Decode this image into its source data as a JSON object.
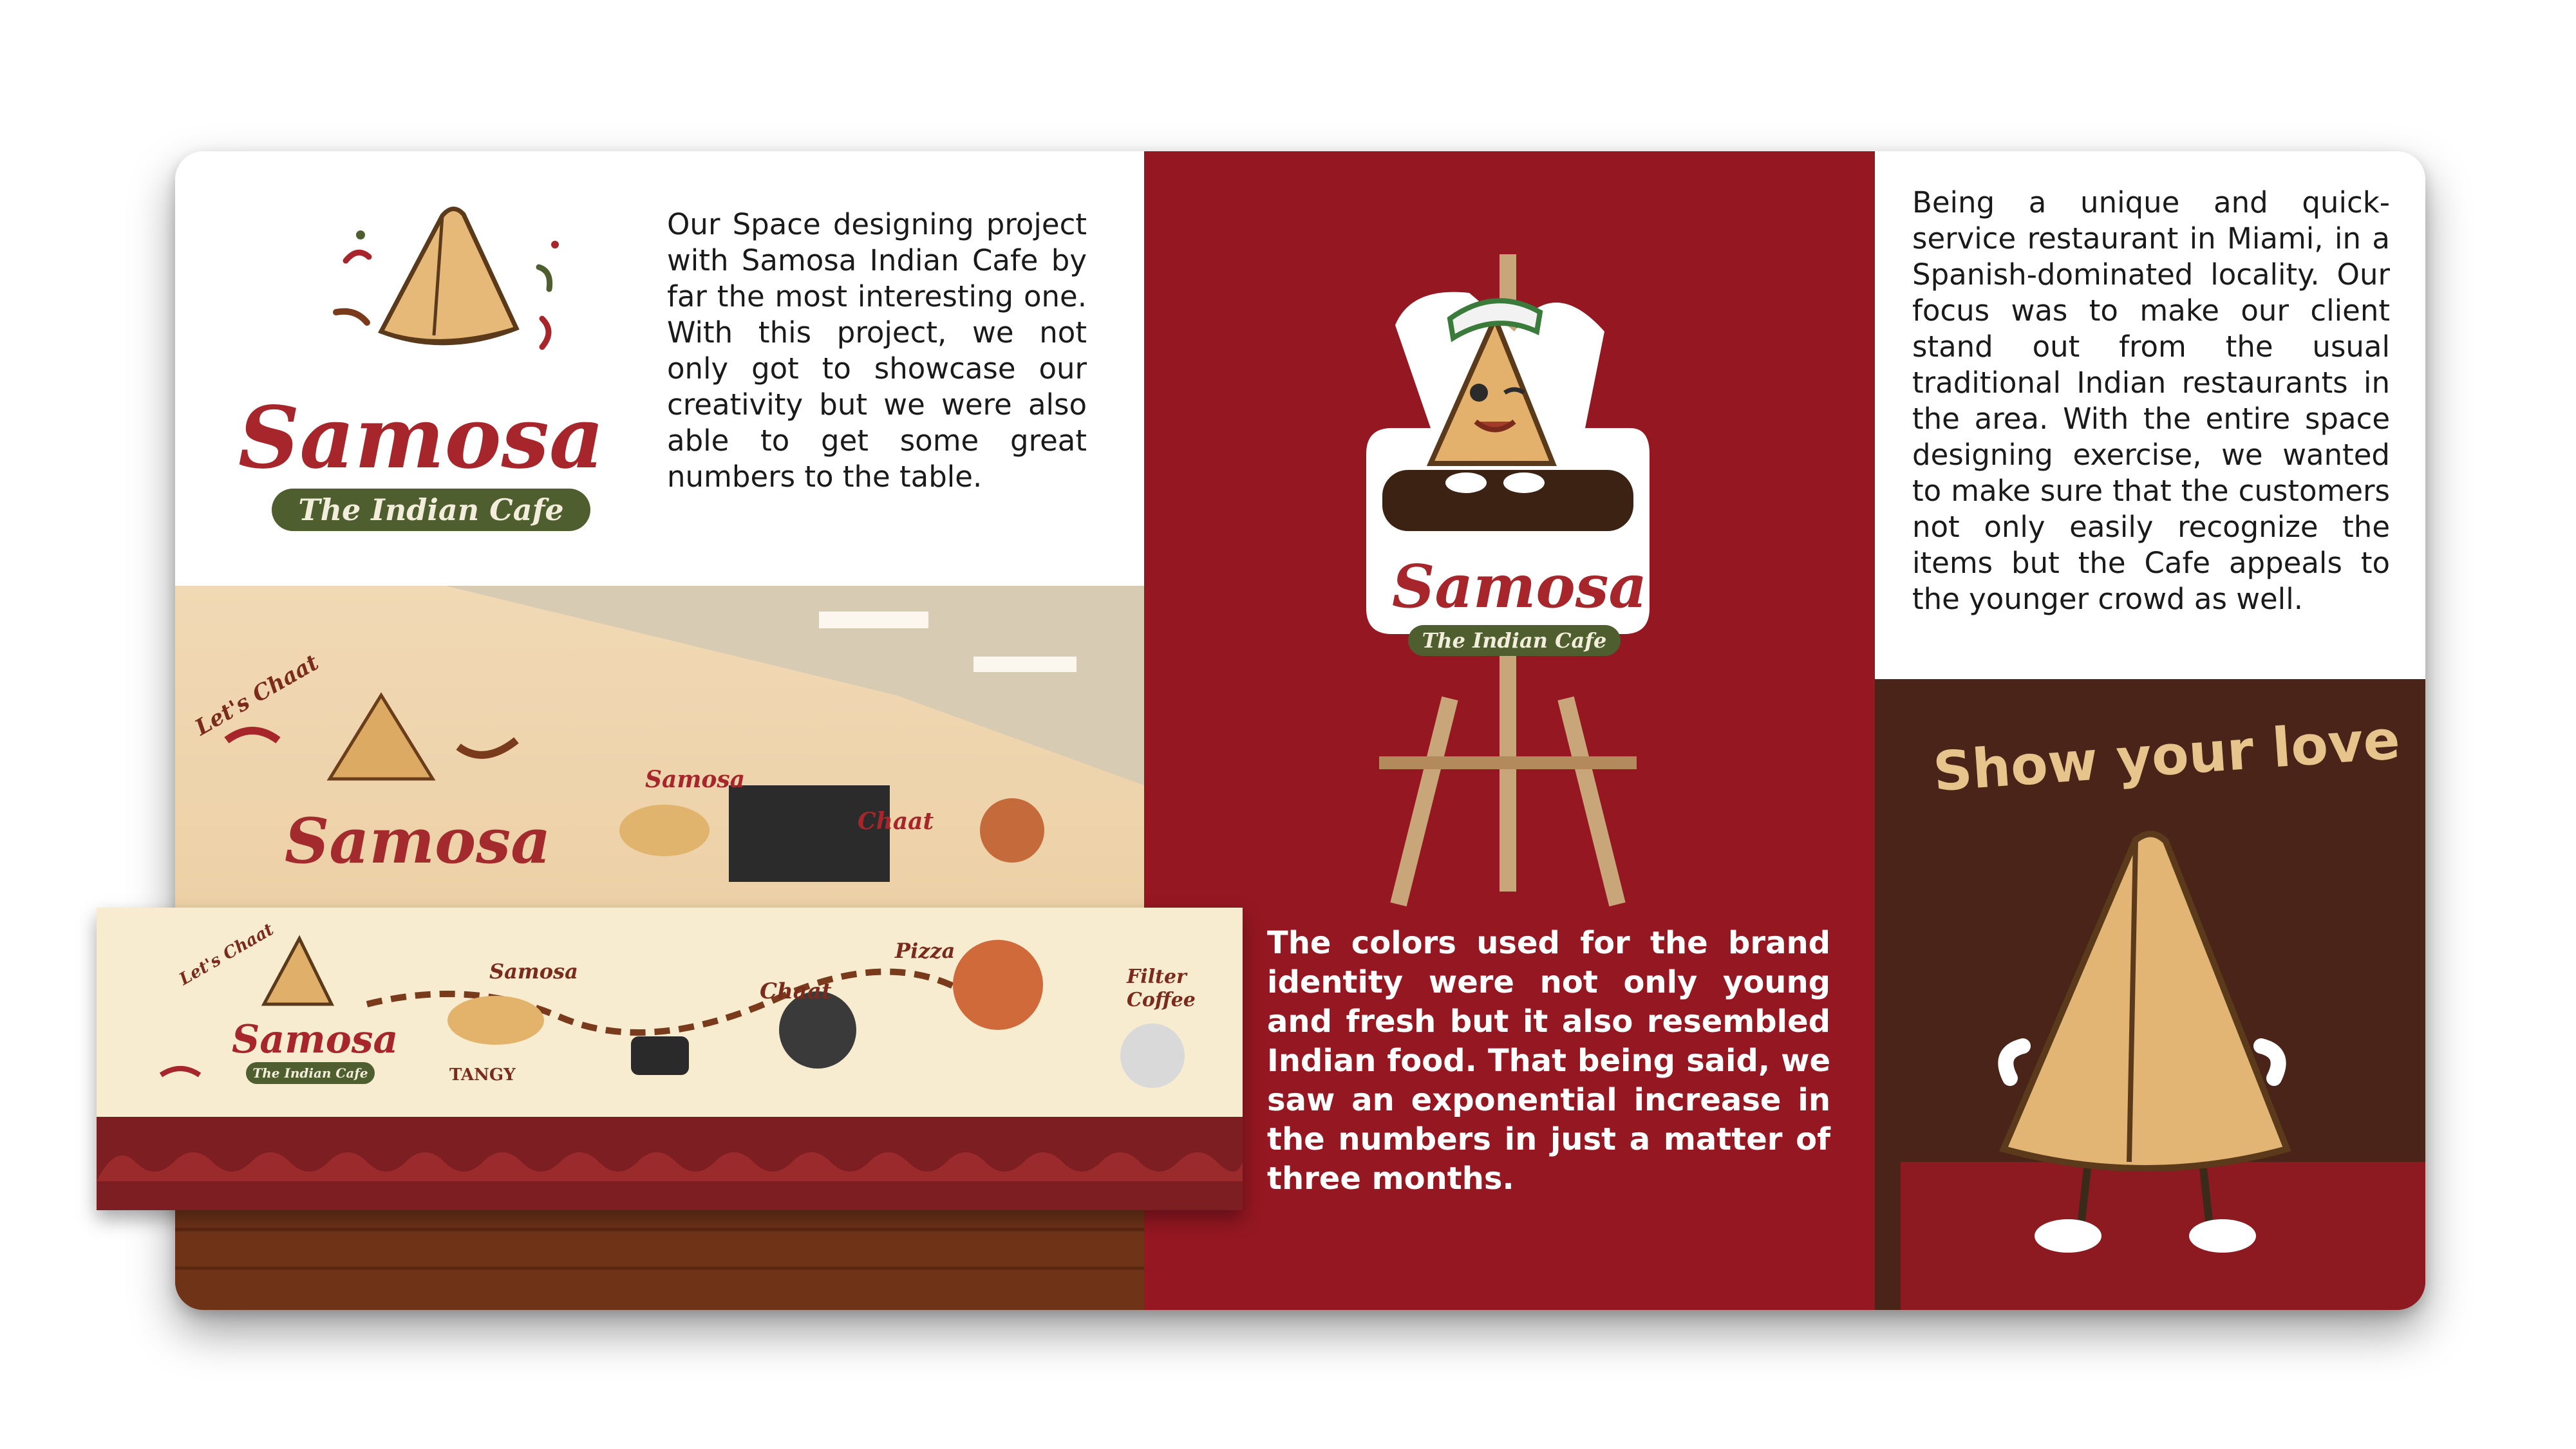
{
  "brand": {
    "name": "Samosa",
    "tagline": "The Indian Cafe"
  },
  "paragraphs": {
    "intro": "Our Space designing project with Samosa Indian Cafe by far the most interesting one. With this project, we not only got to showcase our creativity but we were also able to get some great numbers to the table.",
    "colors": "The colors used for the brand identity were not only young and fresh but it also resembled Indian food. That being said, we saw an exponential increase in the numbers in just a matter of three months.",
    "focus": "Being a unique and quick-service restaurant in Miami, in a Spanish-dominated locality. Our focus was to make our client stand out from the usual traditional Indian restaurants in the area. With the entire space designing exercise, we wanted to make sure that the customers not only easily recognize the items but the Cafe appeals to the younger crowd as well."
  },
  "mural": {
    "heading": "Show your love",
    "badge": "Let's Chaat",
    "items": [
      "Samosa",
      "Chaat",
      "Pizza",
      "Filter Coffee"
    ],
    "sticker": "TANGY"
  },
  "colors": {
    "brand_red": "#951722",
    "brand_green": "#4f5e2f",
    "cream": "#f7ecd0",
    "brown": "#4a2418"
  }
}
